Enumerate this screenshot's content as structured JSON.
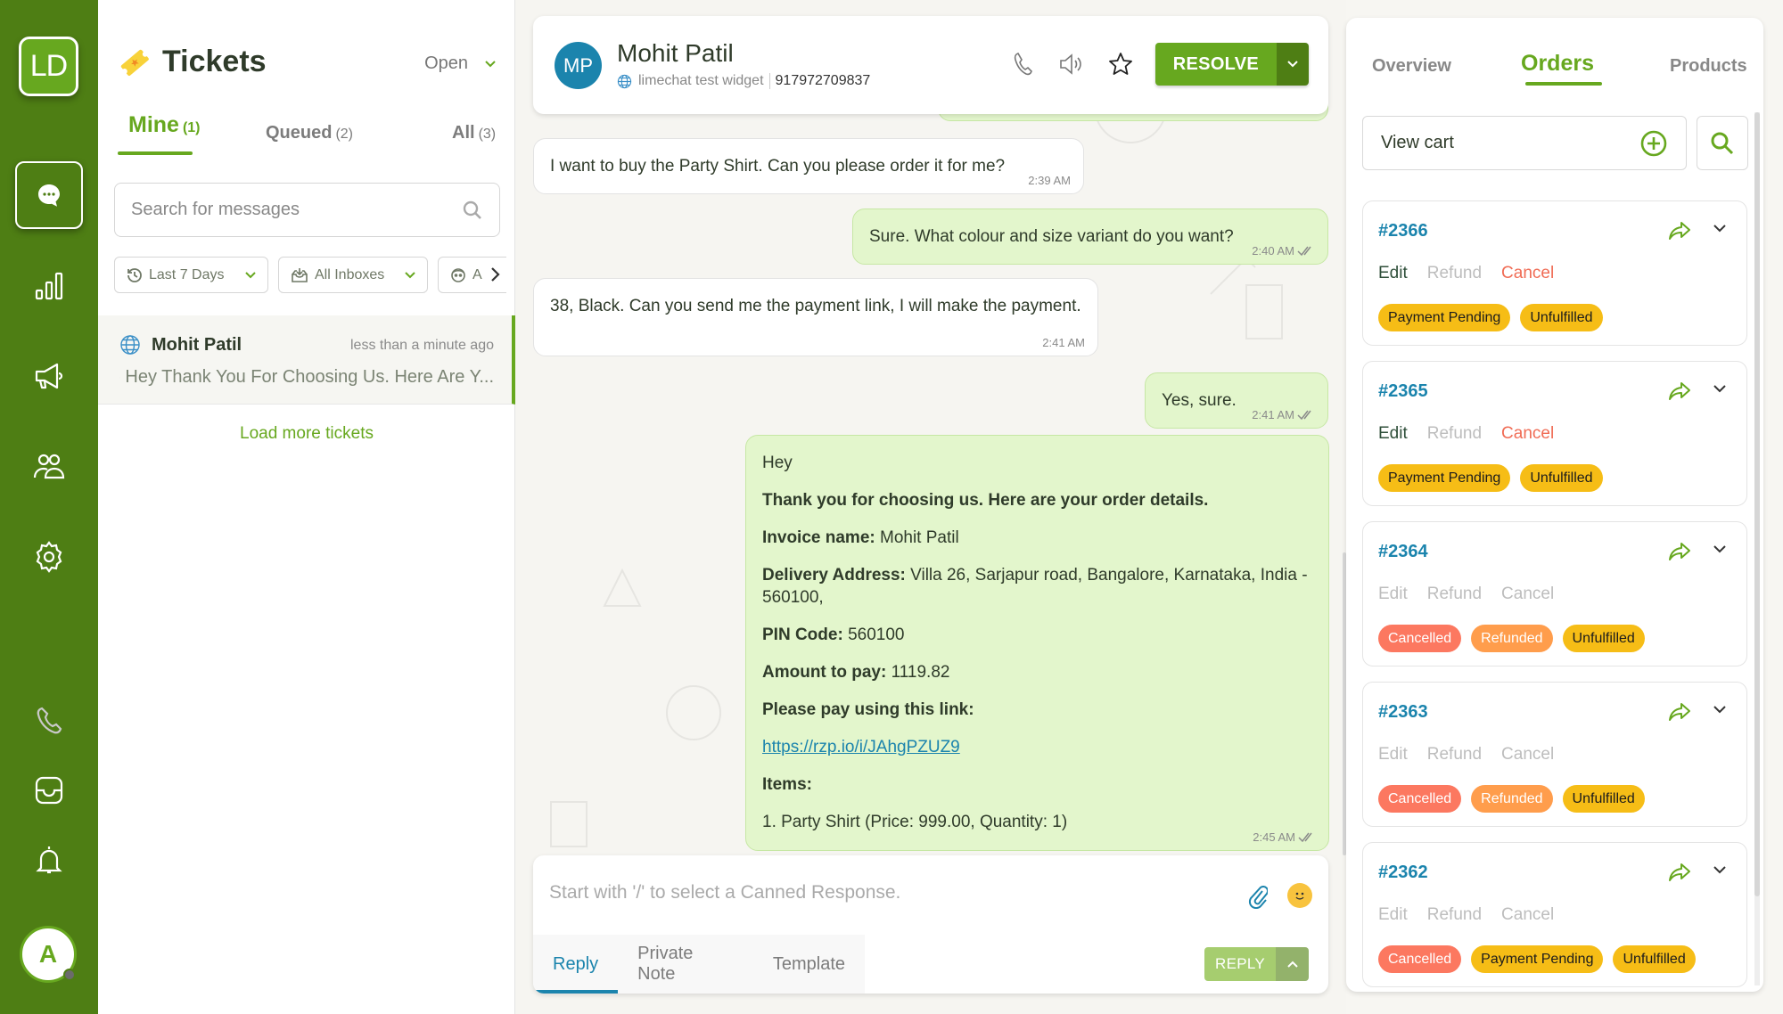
{
  "nav": {
    "logo": "LD",
    "items": [
      {
        "name": "conversations",
        "icon": "chat-bubble-icon",
        "active": true
      },
      {
        "name": "reports",
        "icon": "bar-chart-icon",
        "active": false
      },
      {
        "name": "campaigns",
        "icon": "megaphone-icon",
        "active": false
      },
      {
        "name": "contacts",
        "icon": "users-icon",
        "active": false
      },
      {
        "name": "settings",
        "icon": "gear-icon",
        "active": false
      },
      {
        "name": "calls",
        "icon": "phone-icon",
        "active": false
      },
      {
        "name": "inbox",
        "icon": "tray-icon",
        "active": false
      },
      {
        "name": "notifications",
        "icon": "bell-icon",
        "active": false
      }
    ],
    "avatar_initial": "A"
  },
  "tickets": {
    "title": "Tickets",
    "status_filter": "Open",
    "tabs": [
      {
        "label": "Mine",
        "count": "(1)",
        "active": true
      },
      {
        "label": "Queued",
        "count": "(2)",
        "active": false
      },
      {
        "label": "All",
        "count": "(3)",
        "active": false
      }
    ],
    "search_placeholder": "Search for messages",
    "filters": [
      {
        "label": "Last 7 Days",
        "icon": "history-icon"
      },
      {
        "label": "All Inboxes",
        "icon": "inbox-icon"
      },
      {
        "label": "A",
        "icon": "agent-icon"
      }
    ],
    "items": [
      {
        "name": "Mohit Patil",
        "time": "less than a minute ago",
        "preview": "Hey Thank You For Choosing Us. Here Are Y..."
      }
    ],
    "load_more": "Load more tickets"
  },
  "chat": {
    "contact": {
      "initials": "MP",
      "name": "Mohit Patil",
      "inbox": "limechat test widget",
      "phone": "917972709837"
    },
    "resolve_label": "RESOLVE",
    "messages": [
      {
        "direction": "in",
        "text": "I want to buy the Party Shirt. Can you please order it for me?",
        "time": "2:39 AM"
      },
      {
        "direction": "out",
        "text": "Sure. What colour and size variant do you want?",
        "time": "2:40 AM"
      },
      {
        "direction": "in",
        "text": "38, Black. Can you send me the payment link, I will make the payment.",
        "time": "2:41 AM"
      },
      {
        "direction": "out",
        "text": "Yes, sure.",
        "time": "2:41 AM"
      }
    ],
    "order_message": {
      "greeting": "Hey",
      "intro": "Thank you for choosing us. Here are your order details.",
      "invoice_label": "Invoice name:",
      "invoice_value": "Mohit Patil",
      "address_label": "Delivery Address:",
      "address_value": "Villa 26, Sarjapur road, Bangalore, Karnataka, India - 560100,",
      "pin_label": "PIN Code:",
      "pin_value": "560100",
      "amount_label": "Amount to pay:",
      "amount_value": "1119.82",
      "link_label": "Please pay using this link:",
      "link": "https://rzp.io/i/JAhgPZUZ9",
      "items_label": "Items:",
      "item_1": "1. Party Shirt (Price: 999.00, Quantity: 1)",
      "time": "2:45 AM"
    },
    "composer": {
      "placeholder": "Start with '/' to select a Canned Response.",
      "tabs": [
        "Reply",
        "Private Note",
        "Template"
      ],
      "reply_label": "REPLY"
    }
  },
  "orders_panel": {
    "tabs": [
      "Overview",
      "Orders",
      "Products"
    ],
    "active_tab": "Orders",
    "view_cart": "View cart",
    "orders": [
      {
        "number": "#2366",
        "actions": {
          "edit": "Edit",
          "refund": "Refund",
          "cancel": "Cancel"
        },
        "actions_enabled": true,
        "badges": [
          {
            "label": "Payment Pending",
            "color": "yellow"
          },
          {
            "label": "Unfulfilled",
            "color": "yellow"
          }
        ]
      },
      {
        "number": "#2365",
        "actions": {
          "edit": "Edit",
          "refund": "Refund",
          "cancel": "Cancel"
        },
        "actions_enabled": true,
        "badges": [
          {
            "label": "Payment Pending",
            "color": "yellow"
          },
          {
            "label": "Unfulfilled",
            "color": "yellow"
          }
        ]
      },
      {
        "number": "#2364",
        "actions": {
          "edit": "Edit",
          "refund": "Refund",
          "cancel": "Cancel"
        },
        "actions_enabled": false,
        "badges": [
          {
            "label": "Cancelled",
            "color": "red"
          },
          {
            "label": "Refunded",
            "color": "orange"
          },
          {
            "label": "Unfulfilled",
            "color": "yellow"
          }
        ]
      },
      {
        "number": "#2363",
        "actions": {
          "edit": "Edit",
          "refund": "Refund",
          "cancel": "Cancel"
        },
        "actions_enabled": false,
        "badges": [
          {
            "label": "Cancelled",
            "color": "red"
          },
          {
            "label": "Refunded",
            "color": "orange"
          },
          {
            "label": "Unfulfilled",
            "color": "yellow"
          }
        ]
      },
      {
        "number": "#2362",
        "actions": {
          "edit": "Edit",
          "refund": "Refund",
          "cancel": "Cancel"
        },
        "actions_enabled": false,
        "badges": [
          {
            "label": "Cancelled",
            "color": "red"
          },
          {
            "label": "Payment Pending",
            "color": "yellow"
          },
          {
            "label": "Unfulfilled",
            "color": "yellow"
          }
        ]
      }
    ]
  },
  "colors": {
    "brand_green": "#67a81f",
    "nav_green": "#4e7e14",
    "link_blue": "#1b84ad",
    "outgoing_bubble": "#e3f6cc",
    "badge_yellow": "#f6bd16",
    "badge_red": "#fc7860",
    "badge_orange": "#ff9d4c",
    "cancel_red": "#f06c55"
  }
}
